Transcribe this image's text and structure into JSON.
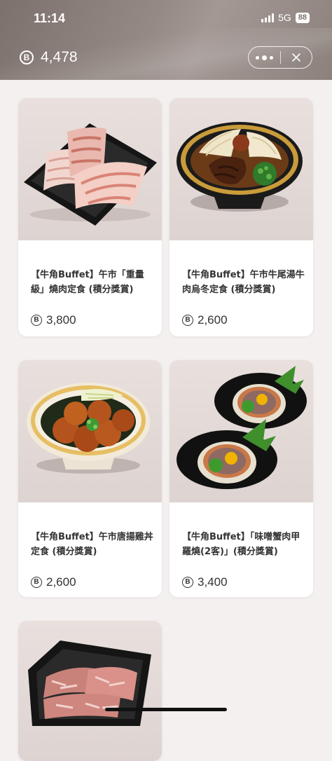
{
  "status": {
    "time": "11:14",
    "network": "5G",
    "battery": "88"
  },
  "header": {
    "points_icon": "coin-b-icon",
    "points_symbol": "B",
    "points_value": "4,478",
    "more_icon": "more-dots-icon",
    "close_icon": "close-icon"
  },
  "products": [
    {
      "title": "【牛角Buffet】午市「重量級」燒肉定食 (積分獎賞)",
      "price_symbol": "B",
      "price": "3,800",
      "image": "grilled-pork-slices-tray"
    },
    {
      "title": "【牛角Buffet】午市牛尾湯牛肉烏冬定食 (積分獎賞)",
      "price_symbol": "B",
      "price": "2,600",
      "image": "oxtail-beef-udon-bowl"
    },
    {
      "title": "【牛角Buffet】午市唐揚雞丼定食 (積分獎賞)",
      "price_symbol": "B",
      "price": "2,600",
      "image": "karaage-chicken-rice-bowl"
    },
    {
      "title": "【牛角Buffet】「味噌蟹肉甲羅燒(2客)」(積分獎賞)",
      "price_symbol": "B",
      "price": "3,400",
      "image": "miso-crab-shell-plates"
    },
    {
      "title": "",
      "price_symbol": "",
      "price": "",
      "image": "marbled-beef-tray"
    }
  ]
}
